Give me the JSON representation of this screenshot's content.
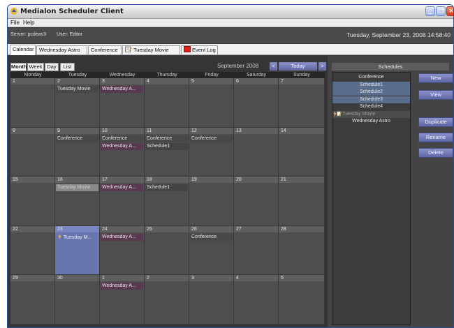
{
  "window": {
    "title": "Medialon Scheduler Client"
  },
  "menu": [
    "File",
    "Help"
  ],
  "status": {
    "server": "Server: pcdeav3",
    "user": "User: Editor",
    "datetime": "Tuesday, September 23, 2008 14:58:40"
  },
  "tabs": [
    {
      "label": "Calendar",
      "icon": ""
    },
    {
      "label": "Wednesday Astro",
      "icon": ""
    },
    {
      "label": "Conference",
      "icon": ""
    },
    {
      "label": "Tuesday Movie",
      "icon": "edit-schedule-icon"
    },
    {
      "label": "Event Log",
      "icon": "red-square-icon"
    }
  ],
  "calendar": {
    "views": [
      "Month",
      "Week",
      "Day",
      "List"
    ],
    "month_label": "September 2008",
    "prev": "<",
    "today": "Today",
    "next": ">",
    "weekdays": [
      "Monday",
      "Tuesday",
      "Wednesday",
      "Thursday",
      "Friday",
      "Saturday",
      "Sunday"
    ],
    "weeks": [
      {
        "days": [
          {
            "n": "1",
            "events": []
          },
          {
            "n": "2",
            "events": [
              {
                "t": "Tuesday Movie",
                "k": "tm"
              }
            ]
          },
          {
            "n": "3",
            "events": [
              {
                "t": "Wednesday A...",
                "k": "wa"
              }
            ]
          },
          {
            "n": "4",
            "events": []
          },
          {
            "n": "5",
            "events": []
          },
          {
            "n": "6",
            "events": []
          },
          {
            "n": "7",
            "events": []
          }
        ]
      },
      {
        "days": [
          {
            "n": "8",
            "events": []
          },
          {
            "n": "9",
            "events": [
              {
                "t": "Conference",
                "k": "conf"
              }
            ]
          },
          {
            "n": "10",
            "events": [
              {
                "t": "Conference",
                "k": "conf"
              },
              {
                "t": "Wednesday A...",
                "k": "wa"
              }
            ]
          },
          {
            "n": "11",
            "events": [
              {
                "t": "Conference",
                "k": "conf"
              },
              {
                "t": "Schedule1",
                "k": "s1"
              }
            ]
          },
          {
            "n": "12",
            "events": [
              {
                "t": "Conference",
                "k": "conf"
              }
            ]
          },
          {
            "n": "13",
            "events": []
          },
          {
            "n": "14",
            "events": []
          }
        ]
      },
      {
        "days": [
          {
            "n": "15",
            "events": []
          },
          {
            "n": "16",
            "events": [
              {
                "t": "Tuesday Movie",
                "k": "tm-light"
              }
            ]
          },
          {
            "n": "17",
            "events": [
              {
                "t": "Wednesday A...",
                "k": "wa"
              }
            ]
          },
          {
            "n": "18",
            "events": [
              {
                "t": "Schedule1",
                "k": "s1"
              }
            ]
          },
          {
            "n": "19",
            "events": []
          },
          {
            "n": "20",
            "events": []
          },
          {
            "n": "21",
            "events": []
          }
        ]
      },
      {
        "days": [
          {
            "n": "22",
            "events": []
          },
          {
            "n": "23",
            "events": [
              {
                "t": "Tuesday M...",
                "k": "tm-sel",
                "icon": "lightning-icon"
              }
            ],
            "selected": true
          },
          {
            "n": "24",
            "events": [
              {
                "t": "Wednesday A...",
                "k": "wa"
              }
            ]
          },
          {
            "n": "25",
            "events": []
          },
          {
            "n": "26",
            "events": [
              {
                "t": "Conference",
                "k": "conf"
              }
            ]
          },
          {
            "n": "27",
            "events": []
          },
          {
            "n": "28",
            "events": []
          }
        ]
      },
      {
        "days": [
          {
            "n": "29",
            "events": []
          },
          {
            "n": "30",
            "events": []
          },
          {
            "n": "1",
            "events": [
              {
                "t": "Wednesday A...",
                "k": "wa"
              }
            ]
          },
          {
            "n": "2",
            "events": []
          },
          {
            "n": "3",
            "events": []
          },
          {
            "n": "4",
            "events": []
          },
          {
            "n": "5",
            "events": []
          }
        ]
      }
    ]
  },
  "schedules": {
    "header": "Schedules",
    "items": [
      {
        "label": "Conference",
        "style": "plain"
      },
      {
        "label": "Schedule1",
        "style": "hl"
      },
      {
        "label": "Schedule2",
        "style": "hl"
      },
      {
        "label": "Schedule3",
        "style": "hl"
      },
      {
        "label": "Schedule4",
        "style": "plain"
      },
      {
        "label": "Tuesday Movie",
        "style": "dim",
        "icon": "lightning-edit-icon"
      },
      {
        "label": "Wednesday Astro",
        "style": "plain"
      }
    ],
    "buttons": [
      "New",
      "View",
      "Duplicate",
      "Rename",
      "Delete"
    ]
  },
  "colors": {
    "accent_blue": "#6875ae",
    "wednesday_event": "#593851",
    "panel_bg": "#4e4e4e"
  }
}
